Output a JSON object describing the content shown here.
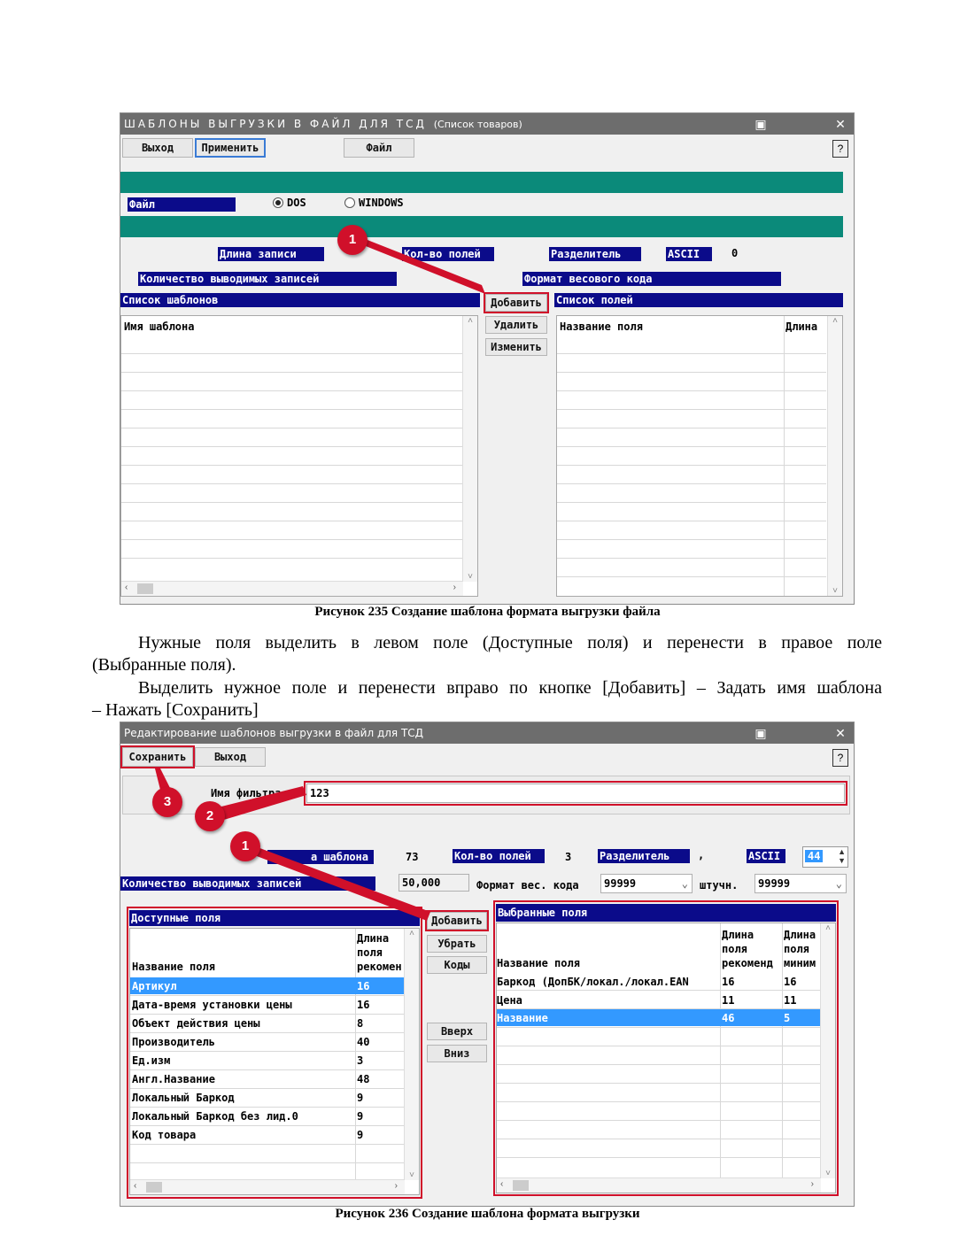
{
  "window1": {
    "title_spaced": "ШАБЛОНЫ ВЫГРУЗКИ В ФАЙЛ ДЛЯ ТСД",
    "title_suffix": "(Список товаров)",
    "buttons": {
      "exit": "Выход",
      "apply": "Применить",
      "file": "Файл"
    },
    "file_label": "Файл",
    "radio_dos": "DOS",
    "radio_windows": "WINDOWS",
    "record_length_label": "Длина записи",
    "field_count_label": "Кол-во полей",
    "separator_label": "Разделитель",
    "ascii_label": "ASCII",
    "ascii_value": "0",
    "output_records_label": "Количество выводимых записей",
    "weight_format_label": "Формат весового кода",
    "template_list_label": "Список шаблонов",
    "side_buttons": {
      "add": "Добавить",
      "delete": "Удалить",
      "edit": "Изменить"
    },
    "field_list_label": "Список полей",
    "template_col": "Имя шаблона",
    "field_name_col": "Название поля",
    "length_col": "Длина"
  },
  "caption1": "Рисунок 235 Создание шаблона формата выгрузки файла",
  "paragraph": {
    "line1": "Нужные поля выделить в левом поле (Доступные поля) и перенести в правое поле",
    "line2": "(Выбранные поля).",
    "line3": "Выделить нужное поле и перенести вправо по кнопке [Добавить] – Задать имя шаблона",
    "line4": "– Нажать [Сохранить]"
  },
  "window2": {
    "title": "Редактирование шаблонов выгрузки в файл для ТСД",
    "buttons": {
      "save": "Сохранить",
      "exit": "Выход"
    },
    "filter_label": "Имя фильтра:",
    "filter_value": "123",
    "template_length_label": "а шаблона",
    "template_length_value": "73",
    "field_count_label": "Кол-во полей",
    "field_count_value": "3",
    "separator_label": "Разделитель",
    "separator_value": ",",
    "ascii_label": "ASCII",
    "ascii_value": "44",
    "output_records_label": "Количество выводимых записей",
    "output_records_value": "50,000",
    "weight_format_label": "Формат вес. кода",
    "weight_format_value": "99999",
    "piece_label": "штучн.",
    "piece_value": "99999",
    "available_title": "Доступные поля",
    "available_cols": {
      "name": "Название поля",
      "length_l1": "Длина",
      "length_l2": "поля",
      "length_l3": "рекомен"
    },
    "available_rows": [
      {
        "name": "Артикул",
        "len": "16"
      },
      {
        "name": "Дата-время установки цены",
        "len": "16"
      },
      {
        "name": "Объект действия цены",
        "len": "8"
      },
      {
        "name": "Производитель",
        "len": "40"
      },
      {
        "name": "Ед.изм",
        "len": "3"
      },
      {
        "name": "Англ.Название",
        "len": "48"
      },
      {
        "name": "Локальный Баркод",
        "len": "9"
      },
      {
        "name": "Локальный Баркод без лид.0",
        "len": "9"
      },
      {
        "name": "Код товара",
        "len": "9"
      }
    ],
    "middle_buttons": {
      "add": "Добавить",
      "remove": "Убрать",
      "codes": "Коды",
      "up": "Вверх",
      "down": "Вниз"
    },
    "selected_title": "Выбранные поля",
    "selected_cols": {
      "name": "Название поля",
      "rec_l1": "Длина",
      "rec_l2": "поля",
      "rec_l3": "рекоменд",
      "min_l1": "Длина",
      "min_l2": "поля",
      "min_l3": "миним"
    },
    "selected_rows": [
      {
        "name": "Баркод (ДопБК/локал./локал.EAN",
        "rec": "16",
        "min": "16"
      },
      {
        "name": "Цена",
        "rec": "11",
        "min": "11"
      },
      {
        "name": "Название",
        "rec": "46",
        "min": "5"
      }
    ]
  },
  "caption2": "Рисунок 236 Создание шаблона формата выгрузки",
  "callouts": {
    "n1": "1",
    "n2": "2",
    "n3": "3"
  },
  "colors": {
    "navy": "#0b0b8a",
    "teal": "#0b8a7a",
    "accent_red": "#d0102a",
    "selection": "#3399ff",
    "titlebar": "#6d6d6d"
  }
}
